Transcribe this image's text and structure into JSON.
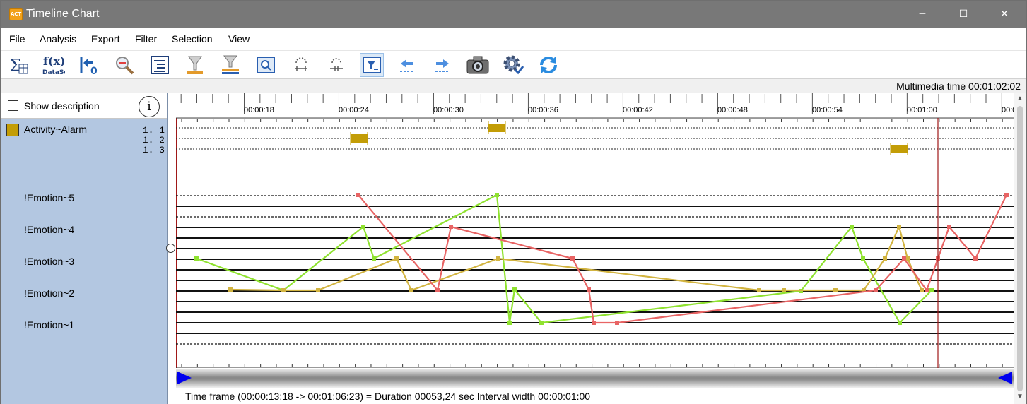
{
  "window": {
    "title": "Timeline Chart",
    "app_icon_text": "ACT",
    "controls": {
      "minimize": "─",
      "maximize": "☐",
      "close": "✕"
    }
  },
  "menu": [
    "File",
    "Analysis",
    "Export",
    "Filter",
    "Selection",
    "View"
  ],
  "toolbar": {
    "buttons": [
      "sum-table-icon",
      "function-dataset-icon",
      "go-to-start-icon",
      "zoom-out-icon",
      "outline-icon",
      "filter-icon",
      "filter-list-icon",
      "zoom-window-icon",
      "expand-icon",
      "collapse-icon",
      "time-filter-icon",
      "previous-icon",
      "next-icon",
      "camera-icon",
      "settings-icon",
      "refresh-icon"
    ],
    "fx_text": "f(x)",
    "dataset_text": "DataSet",
    "goto_start_text": "0"
  },
  "multimedia_time": "Multimedia time 00:01:02:02",
  "left_panel": {
    "show_description": "Show description",
    "info_glyph": "i",
    "activity_label": "Activity~Alarm",
    "activity_color": "#c39d06",
    "levels": [
      "1. 1",
      "1. 2",
      "1. 3"
    ],
    "emotions": [
      "!Emotion~5",
      "!Emotion~4",
      "!Emotion~3",
      "!Emotion~2",
      "!Emotion~1"
    ]
  },
  "ruler": {
    "labels": [
      "00:00:18",
      "00:00:24",
      "00:00:30",
      "00:00:36",
      "00:00:42",
      "00:00:48",
      "00:00:54",
      "00:01:00",
      "00:0"
    ]
  },
  "colors": {
    "green": "#8fe22f",
    "red": "#e86464",
    "gold": "#d2b440",
    "event": "#c39d06",
    "cursor": "#a01818",
    "slider_marker": "#0000ee"
  },
  "status": "Time frame  (00:00:13:18 -> 00:01:06:23) = Duration 00053,24 sec   Interval width 00:00:01:00"
}
